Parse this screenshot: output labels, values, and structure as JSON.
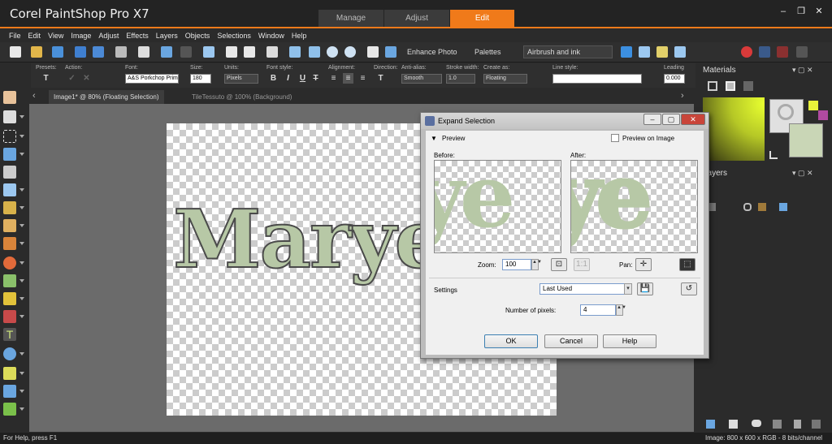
{
  "app": {
    "title": "Corel PaintShop Pro X7",
    "workspaces": [
      "Manage",
      "Adjust",
      "Edit"
    ],
    "active_workspace": "Edit",
    "window_controls": [
      "–",
      "❐",
      "✕"
    ]
  },
  "menu": [
    "File",
    "Edit",
    "View",
    "Image",
    "Adjust",
    "Effects",
    "Layers",
    "Objects",
    "Selections",
    "Window",
    "Help"
  ],
  "toolbar": {
    "enhance_photo": "Enhance Photo",
    "palettes": "Palettes",
    "brush_combo": "Airbrush and ink"
  },
  "tool_options": {
    "presets_label": "Presets:",
    "action_label": "Action:",
    "font_label": "Font:",
    "font_value": "A&S Porkchop Prim",
    "size_label": "Size:",
    "size_value": "180",
    "units_label": "Units:",
    "units_value": "Pixels",
    "font_style_label": "Font style:",
    "bold": "B",
    "italic": "I",
    "underline": "U",
    "strike": "T",
    "alignment_label": "Alignment:",
    "direction_label": "Direction:",
    "antialias_label": "Anti-alias:",
    "antialias_value": "Smooth",
    "stroke_label": "Stroke width:",
    "stroke_value": "1.0",
    "create_as_label": "Create as:",
    "create_as_value": "Floating",
    "line_style_label": "Line style:",
    "leading_label": "Leading",
    "leading_value": "0.000"
  },
  "doc_tabs": [
    {
      "label": "Image1* @  80% (Floating Selection)",
      "active": true
    },
    {
      "label": "TileTessuto @ 100% (Background)",
      "active": false
    }
  ],
  "canvas_text": "Marye",
  "panels": {
    "materials_title": "Materials",
    "layers_title": "Layers",
    "foreground_color": "#e8f23a",
    "background_color": "#c9d6b6"
  },
  "dialog": {
    "title": "Expand Selection",
    "preview_label": "Preview",
    "preview_on_image": "Preview on Image",
    "before_label": "Before:",
    "after_label": "After:",
    "preview_letters": "ye",
    "zoom_label": "Zoom:",
    "zoom_value": "100",
    "pan_label": "Pan:",
    "settings_label": "Settings",
    "settings_value": "Last Used",
    "pixels_label": "Number of pixels:",
    "pixels_value": "4",
    "ok": "OK",
    "cancel": "Cancel",
    "help": "Help"
  },
  "status": {
    "help": "For Help, press F1",
    "image_info": "Image:  800 x 600 x RGB - 8 bits/channel"
  }
}
